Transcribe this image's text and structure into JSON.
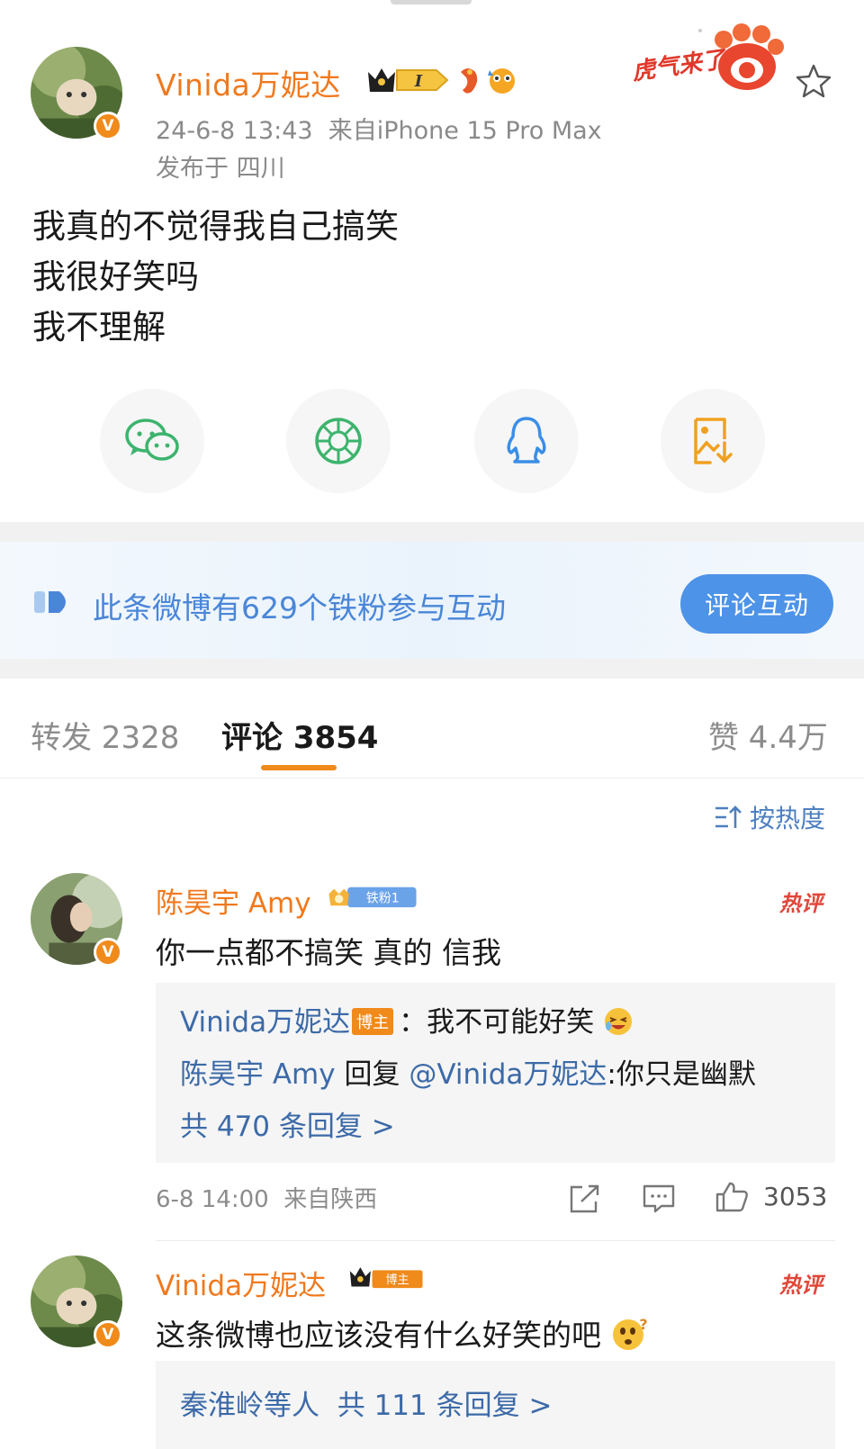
{
  "post": {
    "author": "Vinida万妮达",
    "rank_label": "I",
    "timestamp": "24-6-8 13:43",
    "source": "来自iPhone 15 Pro Max",
    "location": "发布于 四川",
    "sticker_text": "虎气来了",
    "body_lines": [
      "我真的不觉得我自己搞笑",
      "我很好笑吗",
      "我不理解"
    ]
  },
  "share": {
    "buttons": [
      "wechat-icon",
      "moments-icon",
      "qq-icon",
      "save-image-icon"
    ]
  },
  "fan_banner": {
    "text": "此条微博有629个铁粉参与互动",
    "button": "评论互动"
  },
  "tabs": {
    "repost": "转发 2328",
    "comments": "评论 3854",
    "likes": "赞 4.4万"
  },
  "sort": {
    "label": "按热度"
  },
  "comments": [
    {
      "author": "陈昊宇 Amy",
      "badge": "铁粉1",
      "hot_label": "热评",
      "text": "你一点都不搞笑 真的 信我",
      "replies": {
        "line1_author": "Vinida万妮达",
        "line1_tag": "博主",
        "line1_text": "：我不可能好笑",
        "line2_author": "陈昊宇 Amy",
        "line2_verb": "回复",
        "line2_mention": "@Vinida万妮达",
        "line2_text": ":你只是幽默",
        "more": "共 470 条回复 >"
      },
      "time": "6-8 14:00",
      "from": "来自陕西",
      "likes": "3053"
    },
    {
      "author": "Vinida万妮达",
      "badge": "博主",
      "hot_label": "热评",
      "text": "这条微博也应该没有什么好笑的吧",
      "replies": {
        "who": "秦淮岭等人",
        "more": "共 111 条回复 >"
      }
    }
  ],
  "colors": {
    "brand_orange": "#f0791e",
    "link_blue": "#3c6aa8",
    "banner_blue": "#4d93e8",
    "hot_red": "#e0473a"
  }
}
